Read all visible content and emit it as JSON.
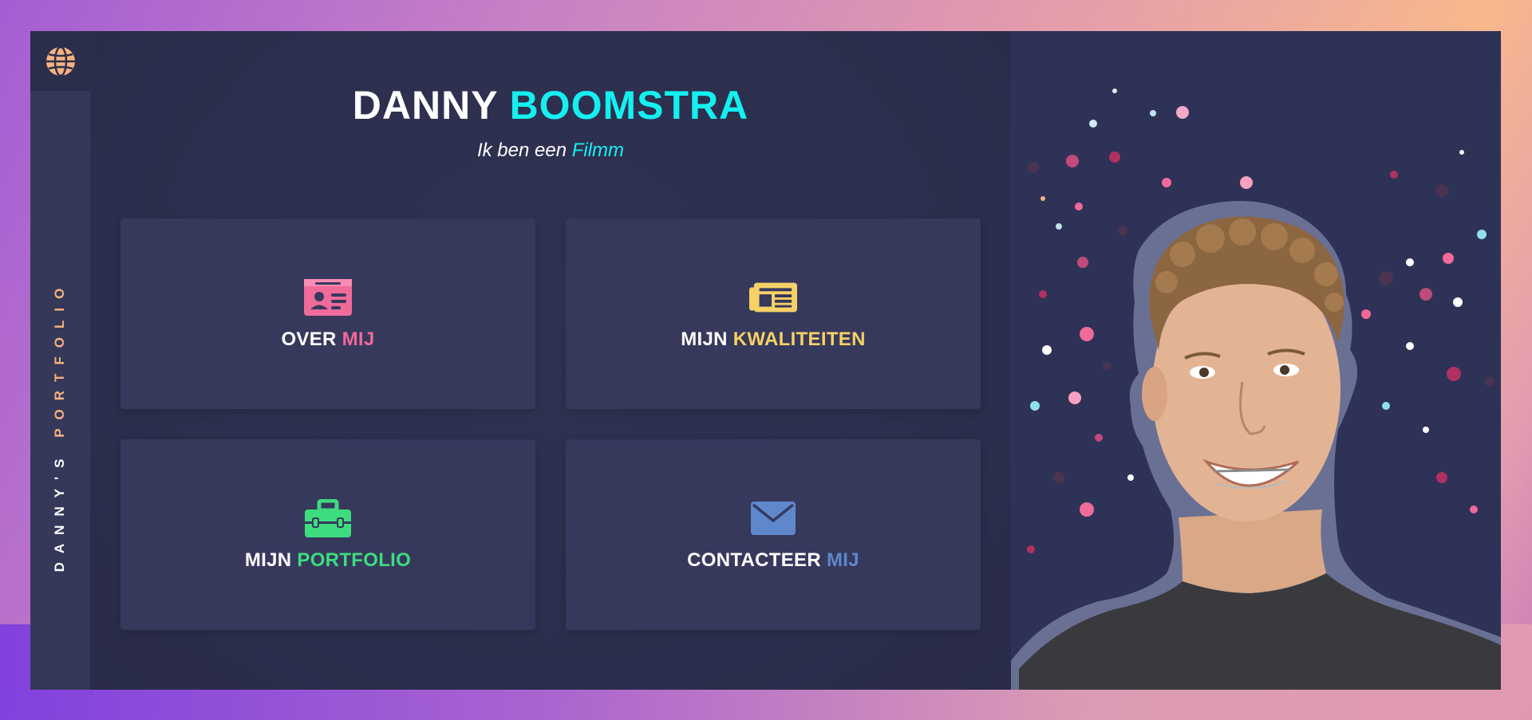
{
  "header": {
    "name_first": "DANNY",
    "name_last": "BOOMSTRA",
    "subtitle_prefix": "Ik ben een",
    "subtitle_accent": "Filmm"
  },
  "sidebar": {
    "label_main": "DANNY'S",
    "label_accent": "PORTFOLIO"
  },
  "cards": [
    {
      "first": "OVER",
      "accent": "MIJ",
      "icon": "id-card-icon",
      "color": "#f06a9a"
    },
    {
      "first": "MIJN",
      "accent": "KWALITEITEN",
      "icon": "newspaper-icon",
      "color": "#f6d166"
    },
    {
      "first": "MIJN",
      "accent": "PORTFOLIO",
      "icon": "toolbox-icon",
      "color": "#3ddc7e"
    },
    {
      "first": "CONTACTEER",
      "accent": "MIJ",
      "icon": "envelope-icon",
      "color": "#5f88cc"
    }
  ],
  "colors": {
    "accent_cyan": "#14f0f0",
    "sidebar_accent": "#f6b27f",
    "globe": "#f6b27f"
  },
  "icons": {
    "globe": "globe-icon"
  }
}
